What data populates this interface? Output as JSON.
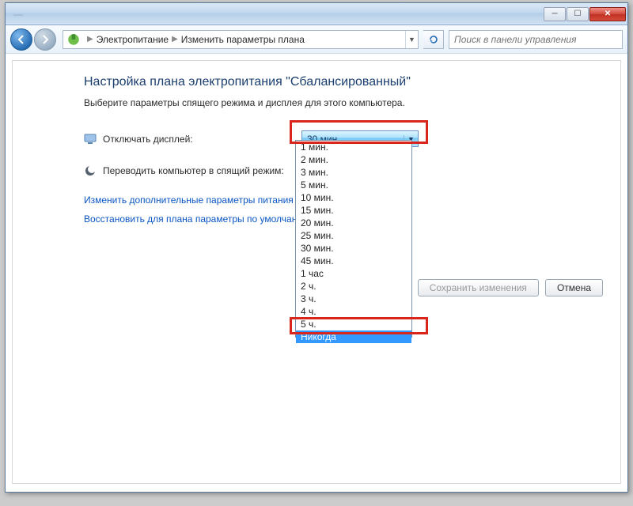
{
  "titlebar": {
    "blurred": "—"
  },
  "nav": {
    "breadcrumbs": [
      "Электропитание",
      "Изменить параметры плана"
    ],
    "search_placeholder": "Поиск в панели управления"
  },
  "page": {
    "heading": "Настройка плана электропитания \"Сбалансированный\"",
    "subheading": "Выберите параметры спящего режима и дисплея для этого компьютера.",
    "row_display_label": "Отключать дисплей:",
    "row_sleep_label": "Переводить компьютер в спящий режим:",
    "link_advanced": "Изменить дополнительные параметры питания",
    "link_restore": "Восстановить для плана параметры по умолчанию",
    "combo_value": "30 мин."
  },
  "dropdown": {
    "options": [
      "1 мин.",
      "2 мин.",
      "3 мин.",
      "5 мин.",
      "10 мин.",
      "15 мин.",
      "20 мин.",
      "25 мин.",
      "30 мин.",
      "45 мин.",
      "1 час",
      "2 ч.",
      "3 ч.",
      "4 ч.",
      "5 ч.",
      "Никогда"
    ],
    "selected_index": 15
  },
  "buttons": {
    "save": "Сохранить изменения",
    "cancel": "Отмена"
  }
}
